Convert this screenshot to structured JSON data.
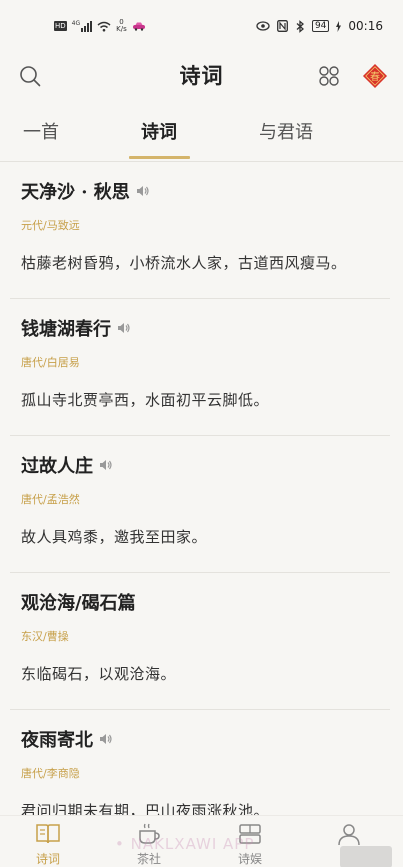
{
  "status": {
    "hd": "HD",
    "signal_label": "4G",
    "speed_value": "0",
    "speed_unit": "K/s",
    "battery": "94",
    "time": "00:16"
  },
  "header": {
    "title": "诗词",
    "accent": "#c7a04a",
    "seal_char": "春"
  },
  "tabs": [
    {
      "label": "一首",
      "active": false
    },
    {
      "label": "诗词",
      "active": true
    },
    {
      "label": "与君语",
      "active": false
    }
  ],
  "poems": [
    {
      "title": "天净沙 · 秋思",
      "author": "元代/马致远",
      "line": "枯藤老树昏鸦，小桥流水人家，古道西风瘦马。"
    },
    {
      "title": "钱塘湖春行",
      "author": "唐代/白居易",
      "line": "孤山寺北贾亭西，水面初平云脚低。"
    },
    {
      "title": "过故人庄",
      "author": "唐代/孟浩然",
      "line": "故人具鸡黍，邀我至田家。"
    },
    {
      "title": "观沧海/碣石篇",
      "author": "东汉/曹操",
      "line": "东临碣石，以观沧海。"
    },
    {
      "title": "夜雨寄北",
      "author": "唐代/李商隐",
      "line": "君问归期未有期，巴山夜雨涨秋池。"
    }
  ],
  "bottom_nav": [
    {
      "label": "诗词",
      "icon": "book-icon",
      "active": true
    },
    {
      "label": "茶社",
      "icon": "tea-cup-icon",
      "active": false
    },
    {
      "label": "诗娱",
      "icon": "game-icon",
      "active": false
    },
    {
      "label": "",
      "icon": "profile-icon",
      "active": false
    }
  ],
  "watermark": "• NAKLXAWI APP"
}
